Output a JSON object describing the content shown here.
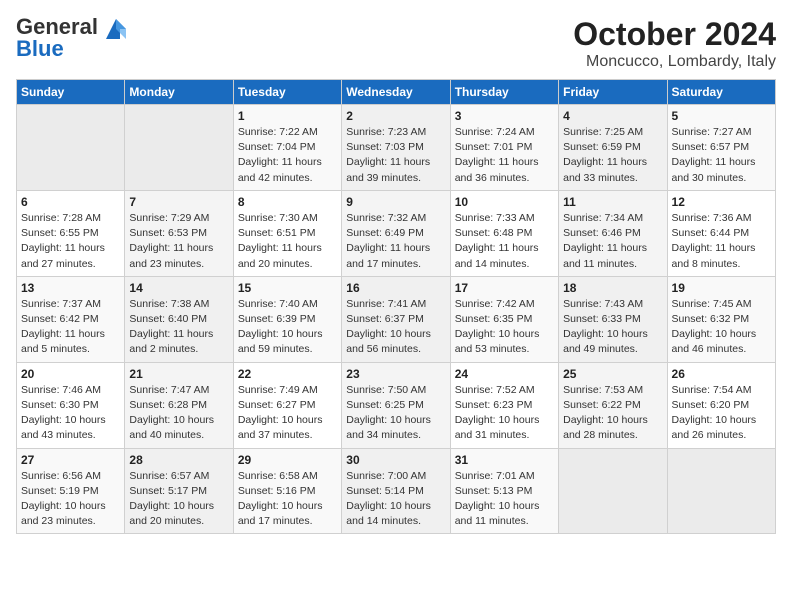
{
  "header": {
    "logo_general": "General",
    "logo_blue": "Blue",
    "month": "October 2024",
    "location": "Moncucco, Lombardy, Italy"
  },
  "columns": [
    "Sunday",
    "Monday",
    "Tuesday",
    "Wednesday",
    "Thursday",
    "Friday",
    "Saturday"
  ],
  "weeks": [
    [
      {
        "day": "",
        "sunrise": "",
        "sunset": "",
        "daylight": ""
      },
      {
        "day": "",
        "sunrise": "",
        "sunset": "",
        "daylight": ""
      },
      {
        "day": "1",
        "sunrise": "Sunrise: 7:22 AM",
        "sunset": "Sunset: 7:04 PM",
        "daylight": "Daylight: 11 hours and 42 minutes."
      },
      {
        "day": "2",
        "sunrise": "Sunrise: 7:23 AM",
        "sunset": "Sunset: 7:03 PM",
        "daylight": "Daylight: 11 hours and 39 minutes."
      },
      {
        "day": "3",
        "sunrise": "Sunrise: 7:24 AM",
        "sunset": "Sunset: 7:01 PM",
        "daylight": "Daylight: 11 hours and 36 minutes."
      },
      {
        "day": "4",
        "sunrise": "Sunrise: 7:25 AM",
        "sunset": "Sunset: 6:59 PM",
        "daylight": "Daylight: 11 hours and 33 minutes."
      },
      {
        "day": "5",
        "sunrise": "Sunrise: 7:27 AM",
        "sunset": "Sunset: 6:57 PM",
        "daylight": "Daylight: 11 hours and 30 minutes."
      }
    ],
    [
      {
        "day": "6",
        "sunrise": "Sunrise: 7:28 AM",
        "sunset": "Sunset: 6:55 PM",
        "daylight": "Daylight: 11 hours and 27 minutes."
      },
      {
        "day": "7",
        "sunrise": "Sunrise: 7:29 AM",
        "sunset": "Sunset: 6:53 PM",
        "daylight": "Daylight: 11 hours and 23 minutes."
      },
      {
        "day": "8",
        "sunrise": "Sunrise: 7:30 AM",
        "sunset": "Sunset: 6:51 PM",
        "daylight": "Daylight: 11 hours and 20 minutes."
      },
      {
        "day": "9",
        "sunrise": "Sunrise: 7:32 AM",
        "sunset": "Sunset: 6:49 PM",
        "daylight": "Daylight: 11 hours and 17 minutes."
      },
      {
        "day": "10",
        "sunrise": "Sunrise: 7:33 AM",
        "sunset": "Sunset: 6:48 PM",
        "daylight": "Daylight: 11 hours and 14 minutes."
      },
      {
        "day": "11",
        "sunrise": "Sunrise: 7:34 AM",
        "sunset": "Sunset: 6:46 PM",
        "daylight": "Daylight: 11 hours and 11 minutes."
      },
      {
        "day": "12",
        "sunrise": "Sunrise: 7:36 AM",
        "sunset": "Sunset: 6:44 PM",
        "daylight": "Daylight: 11 hours and 8 minutes."
      }
    ],
    [
      {
        "day": "13",
        "sunrise": "Sunrise: 7:37 AM",
        "sunset": "Sunset: 6:42 PM",
        "daylight": "Daylight: 11 hours and 5 minutes."
      },
      {
        "day": "14",
        "sunrise": "Sunrise: 7:38 AM",
        "sunset": "Sunset: 6:40 PM",
        "daylight": "Daylight: 11 hours and 2 minutes."
      },
      {
        "day": "15",
        "sunrise": "Sunrise: 7:40 AM",
        "sunset": "Sunset: 6:39 PM",
        "daylight": "Daylight: 10 hours and 59 minutes."
      },
      {
        "day": "16",
        "sunrise": "Sunrise: 7:41 AM",
        "sunset": "Sunset: 6:37 PM",
        "daylight": "Daylight: 10 hours and 56 minutes."
      },
      {
        "day": "17",
        "sunrise": "Sunrise: 7:42 AM",
        "sunset": "Sunset: 6:35 PM",
        "daylight": "Daylight: 10 hours and 53 minutes."
      },
      {
        "day": "18",
        "sunrise": "Sunrise: 7:43 AM",
        "sunset": "Sunset: 6:33 PM",
        "daylight": "Daylight: 10 hours and 49 minutes."
      },
      {
        "day": "19",
        "sunrise": "Sunrise: 7:45 AM",
        "sunset": "Sunset: 6:32 PM",
        "daylight": "Daylight: 10 hours and 46 minutes."
      }
    ],
    [
      {
        "day": "20",
        "sunrise": "Sunrise: 7:46 AM",
        "sunset": "Sunset: 6:30 PM",
        "daylight": "Daylight: 10 hours and 43 minutes."
      },
      {
        "day": "21",
        "sunrise": "Sunrise: 7:47 AM",
        "sunset": "Sunset: 6:28 PM",
        "daylight": "Daylight: 10 hours and 40 minutes."
      },
      {
        "day": "22",
        "sunrise": "Sunrise: 7:49 AM",
        "sunset": "Sunset: 6:27 PM",
        "daylight": "Daylight: 10 hours and 37 minutes."
      },
      {
        "day": "23",
        "sunrise": "Sunrise: 7:50 AM",
        "sunset": "Sunset: 6:25 PM",
        "daylight": "Daylight: 10 hours and 34 minutes."
      },
      {
        "day": "24",
        "sunrise": "Sunrise: 7:52 AM",
        "sunset": "Sunset: 6:23 PM",
        "daylight": "Daylight: 10 hours and 31 minutes."
      },
      {
        "day": "25",
        "sunrise": "Sunrise: 7:53 AM",
        "sunset": "Sunset: 6:22 PM",
        "daylight": "Daylight: 10 hours and 28 minutes."
      },
      {
        "day": "26",
        "sunrise": "Sunrise: 7:54 AM",
        "sunset": "Sunset: 6:20 PM",
        "daylight": "Daylight: 10 hours and 26 minutes."
      }
    ],
    [
      {
        "day": "27",
        "sunrise": "Sunrise: 6:56 AM",
        "sunset": "Sunset: 5:19 PM",
        "daylight": "Daylight: 10 hours and 23 minutes."
      },
      {
        "day": "28",
        "sunrise": "Sunrise: 6:57 AM",
        "sunset": "Sunset: 5:17 PM",
        "daylight": "Daylight: 10 hours and 20 minutes."
      },
      {
        "day": "29",
        "sunrise": "Sunrise: 6:58 AM",
        "sunset": "Sunset: 5:16 PM",
        "daylight": "Daylight: 10 hours and 17 minutes."
      },
      {
        "day": "30",
        "sunrise": "Sunrise: 7:00 AM",
        "sunset": "Sunset: 5:14 PM",
        "daylight": "Daylight: 10 hours and 14 minutes."
      },
      {
        "day": "31",
        "sunrise": "Sunrise: 7:01 AM",
        "sunset": "Sunset: 5:13 PM",
        "daylight": "Daylight: 10 hours and 11 minutes."
      },
      {
        "day": "",
        "sunrise": "",
        "sunset": "",
        "daylight": ""
      },
      {
        "day": "",
        "sunrise": "",
        "sunset": "",
        "daylight": ""
      }
    ]
  ]
}
